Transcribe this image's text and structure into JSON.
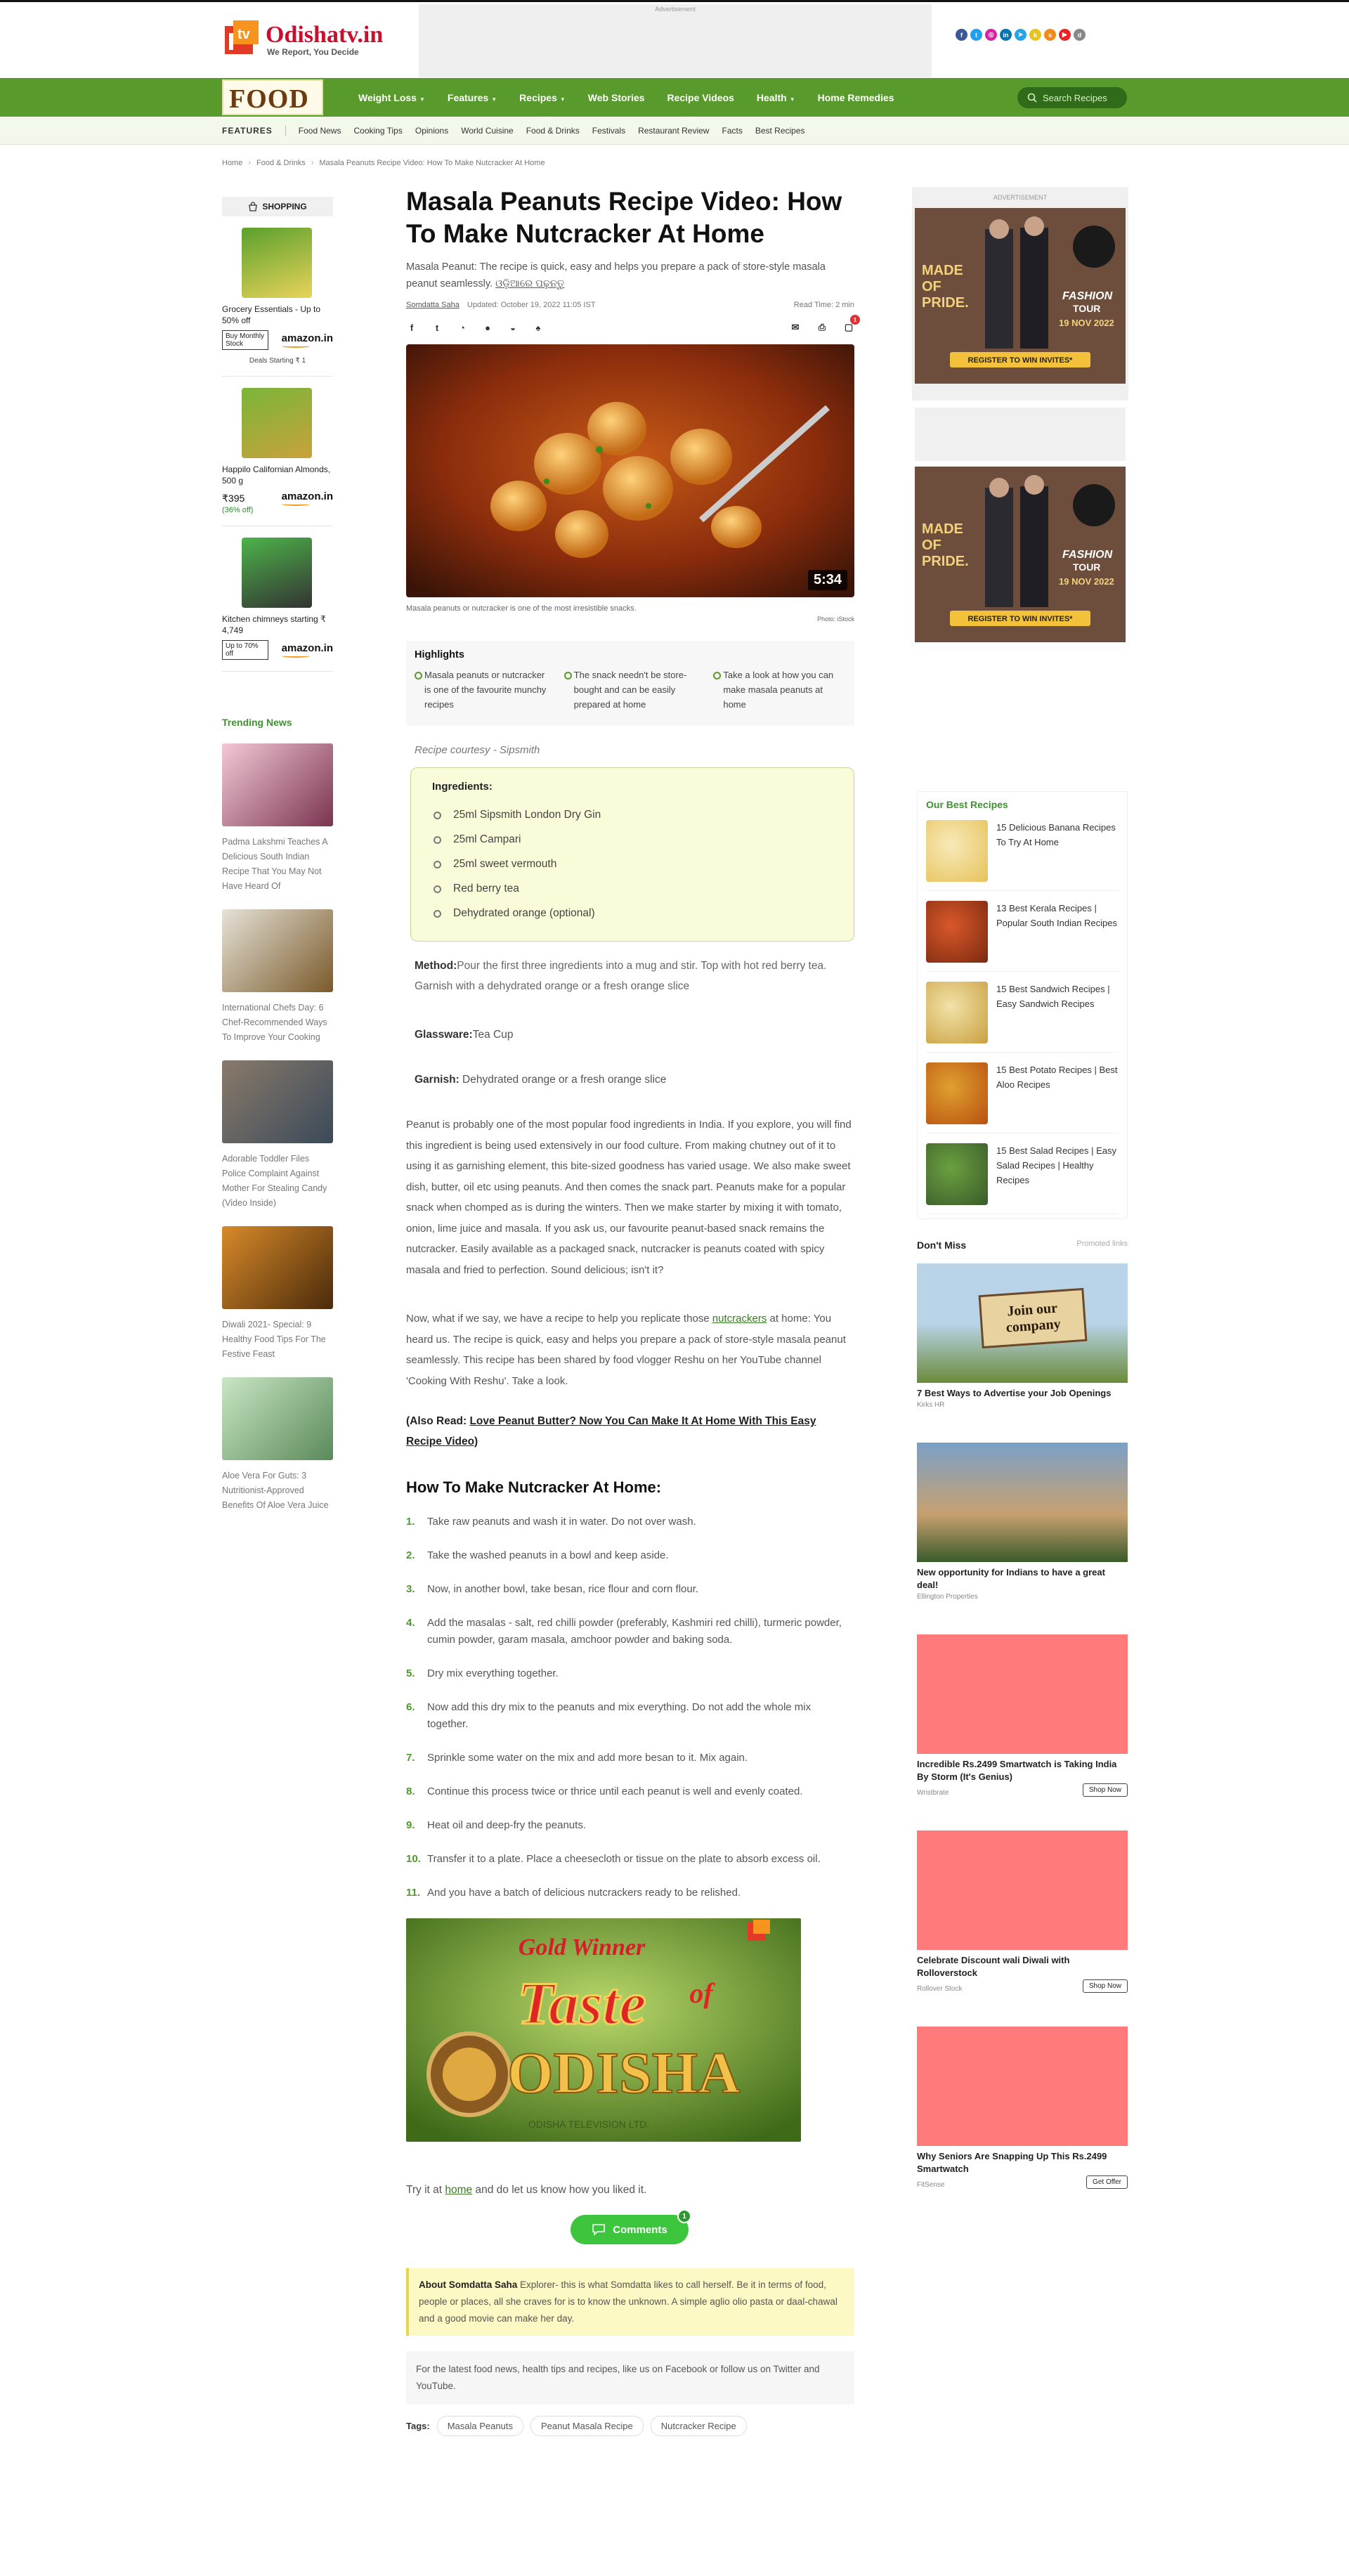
{
  "site": {
    "name": "Odishatv.in",
    "tagline": "We Report, You Decide",
    "ad_label": "Advertisement",
    "social": [
      {
        "icon": "facebook-icon",
        "glyph": "f",
        "color": "#3b5998"
      },
      {
        "icon": "twitter-icon",
        "glyph": "t",
        "color": "#1da1f2"
      },
      {
        "icon": "instagram-icon",
        "glyph": "◎",
        "color": "#d6249f"
      },
      {
        "icon": "linkedin-icon",
        "glyph": "in",
        "color": "#0077b5"
      },
      {
        "icon": "telegram-icon",
        "glyph": "➤",
        "color": "#2aa3e0"
      },
      {
        "icon": "koo-icon",
        "glyph": "k",
        "color": "#e9c41a"
      },
      {
        "icon": "sharechat-icon",
        "glyph": "s",
        "color": "#f08a1a"
      },
      {
        "icon": "youtube-icon",
        "glyph": "▶",
        "color": "#e22"
      },
      {
        "icon": "dailyhunt-icon",
        "glyph": "d",
        "color": "#888"
      }
    ]
  },
  "nav": {
    "section_logo": "FOOD",
    "items": [
      {
        "label": "Weight Loss",
        "caret": true
      },
      {
        "label": "Features",
        "caret": true
      },
      {
        "label": "Recipes",
        "caret": true
      },
      {
        "label": "Web Stories",
        "caret": false
      },
      {
        "label": "Recipe Videos",
        "caret": false
      },
      {
        "label": "Health",
        "caret": true
      },
      {
        "label": "Home Remedies",
        "caret": false
      }
    ],
    "search_label": "Search Recipes"
  },
  "features_bar": {
    "label": "FEATURES",
    "items": [
      "Food News",
      "Cooking Tips",
      "Opinions",
      "World Cuisine",
      "Food & Drinks",
      "Festivals",
      "Restaurant Review",
      "Facts",
      "Best Recipes"
    ]
  },
  "breadcrumb": [
    "Home",
    "Food & Drinks",
    "Masala Peanuts Recipe Video: How To Make Nutcracker At Home"
  ],
  "shopping": {
    "label": "SHOPPING",
    "products": [
      {
        "title": "Grocery Essentials - Up to 50% off",
        "price": "",
        "save": "",
        "btn": "Buy Monthly Stock",
        "brand": "amazon.in",
        "note": "Deals Starting ₹ 1"
      },
      {
        "title": "Happilo Californian Almonds, 500 g",
        "price": "₹395",
        "save": "(36% off)",
        "btn": "",
        "brand": "amazon.in",
        "note": ""
      },
      {
        "title": "Kitchen chimneys starting ₹ 4,749",
        "price": "",
        "save": "",
        "btn": "Up to 70% off",
        "brand": "amazon.in",
        "note": ""
      }
    ]
  },
  "trending": {
    "label": "Trending News",
    "items": [
      "Padma Lakshmi Teaches A Delicious South Indian Recipe That You May Not Have Heard Of",
      "International Chefs Day: 6 Chef-Recommended Ways To Improve Your Cooking",
      "Adorable Toddler Files Police Complaint Against Mother For Stealing Candy (Video Inside)",
      "Diwali 2021- Special: 9 Healthy Food Tips For The Festive Feast",
      "Aloe Vera For Guts: 3 Nutritionist-Approved Benefits Of Aloe Vera Juice"
    ]
  },
  "article": {
    "title": "Masala Peanuts Recipe Video: How To Make Nutcracker At Home",
    "summary": "Masala Peanut: The recipe is quick, easy and helps you prepare a pack of store-style masala peanut seamlessly.",
    "odia_link": "ଓଡ଼ିଆରେ ପଢ଼ନ୍ତୁ",
    "author": "Somdatta Saha",
    "updated": "Updated: October 19, 2022 11:05 IST",
    "read_time": "Read Time: 2 min",
    "comment_badge": "1",
    "video_duration": "5:34",
    "caption": "Masala peanuts or nutcracker is one of the most irresistible snacks.",
    "photo_credit": "Photo: iStock",
    "highlights_label": "Highlights",
    "highlights": [
      "Masala peanuts or nutcracker is one of the favourite munchy recipes",
      "The snack needn't be store-bought and can be easily prepared at home",
      "Take a look at how you can make masala peanuts at home"
    ],
    "courtesy": "Recipe courtesy - Sipsmith",
    "ingredients_label": "Ingredients:",
    "ingredients": [
      "25ml Sipsmith London Dry Gin",
      "25ml Campari",
      "25ml sweet vermouth",
      "Red berry tea",
      "Dehydrated orange (optional)"
    ],
    "method_label": "Method:",
    "method": "Pour the first three ingredients into a mug and stir. Top with hot red berry tea. Garnish with a dehydrated orange or a fresh orange slice",
    "glassware_label": "Glassware:",
    "glassware": "Tea Cup",
    "garnish_label": "Garnish:",
    "garnish": " Dehydrated orange or a fresh orange slice",
    "para1": "Peanut is probably one of the most popular food ingredients in India. If you explore, you will find this ingredient is being used extensively in our food culture. From making chutney out of it to using it as garnishing element, this bite-sized goodness has varied usage. We also make sweet dish, butter, oil etc using peanuts. And then comes the snack part. Peanuts make for a popular snack when chomped as is during the winters. Then we make starter by mixing it with tomato, onion, lime juice and masala. If you ask us, our favourite peanut-based snack remains the nutcracker. Easily available as a packaged snack, nutcracker is peanuts coated with spicy masala and fried to perfection. Sound delicious; isn't it?",
    "para2_a": "Now, what if we say, we have a recipe to help you replicate those ",
    "para2_link": "nutcrackers",
    "para2_b": " at home: You heard us. The recipe is quick, easy and helps you prepare a pack of store-style masala peanut seamlessly. This recipe has been shared by food vlogger Reshu on her YouTube channel 'Cooking With Reshu'. Take a look.",
    "also_prefix": "(Also Read: ",
    "also_link": "Love Peanut Butter? Now You Can Make It At Home With This Easy Recipe Video)",
    "howto_heading": "How To Make Nutcracker At Home:",
    "steps": [
      "Take raw peanuts and wash it in water. Do not over wash.",
      "Take the washed peanuts in a bowl and keep aside.",
      "Now, in another bowl, take besan, rice flour and corn flour.",
      "Add the masalas - salt, red chilli powder (preferably, Kashmiri red chilli), turmeric powder, cumin powder, garam masala, amchoor powder and baking soda.",
      "Dry mix everything together.",
      "Now add this dry mix to the peanuts and mix everything. Do not add the whole mix together.",
      "Sprinkle some water on the mix and add more besan to it. Mix again.",
      "Continue this process twice or thrice until each peanut is well and evenly coated.",
      "Heat oil and deep-fry the peanuts.",
      "Transfer it to a plate. Place a cheesecloth or tissue on the plate to absorb excess oil.",
      "And you have a batch of delicious nutcrackers ready to be relished."
    ],
    "promo_gold": "Gold Winner",
    "promo_title_1": "Taste",
    "promo_title_2": "of",
    "promo_title_3": "ODISHA",
    "promo_footer": "ODISHA TELEVISION LTD.",
    "try_a": "Try it at ",
    "try_link": "home",
    "try_b": " and do let us know how you liked it.",
    "comments_label": "Comments",
    "comments_count": "1",
    "about_label": "About Somdatta Saha",
    "about_text": " Explorer- this is what Somdatta likes to call herself. Be it in terms of food, people or places, all she craves for is to know the unknown. A simple aglio olio pasta or daal-chawal and a good movie can make her day.",
    "follow_text": "For the latest food news, health tips and recipes, like us on Facebook or follow us on Twitter and YouTube.",
    "tags_label": "Tags:",
    "tags": [
      "Masala Peanuts",
      "Peanut Masala Recipe",
      "Nutcracker Recipe"
    ]
  },
  "right": {
    "ad_label": "ADVERTISEMENT",
    "ad_text": {
      "made": "MADE OF PRIDE.",
      "fashion": "FASHION TOUR",
      "date": "19 NOV 2022",
      "cta": "REGISTER TO WIN INVITES*"
    },
    "best_label": "Our Best Recipes",
    "best": [
      "15 Delicious Banana Recipes To Try At Home",
      "13 Best Kerala Recipes | Popular South Indian Recipes",
      "15 Best Sandwich Recipes | Easy Sandwich Recipes",
      "15 Best Potato Recipes | Best Aloo Recipes",
      "15 Best Salad Recipes | Easy Salad Recipes | Healthy Recipes"
    ],
    "dm_label": "Don't Miss",
    "dm_promo": "Promoted links",
    "dm_cards": [
      {
        "title": "7 Best Ways to Advertise your Job Openings",
        "src": "Kirks HR",
        "btn": "",
        "img_text": "Join our company"
      },
      {
        "title": "New opportunity for Indians to have a great deal!",
        "src": "Ellington Properties",
        "btn": "",
        "img_text": ""
      },
      {
        "title": "Incredible Rs.2499 Smartwatch is Taking India By Storm (It's Genius)",
        "src": "Wristbrate",
        "btn": "Shop Now",
        "img_text": ""
      },
      {
        "title": "Celebrate Discount wali Diwali with Rolloverstock",
        "src": "Rollover Stock",
        "btn": "Shop Now",
        "img_text": ""
      },
      {
        "title": "Why Seniors Are Snapping Up This Rs.2499 Smartwatch",
        "src": "FitSense",
        "btn": "Get Offer",
        "img_text": ""
      }
    ]
  }
}
